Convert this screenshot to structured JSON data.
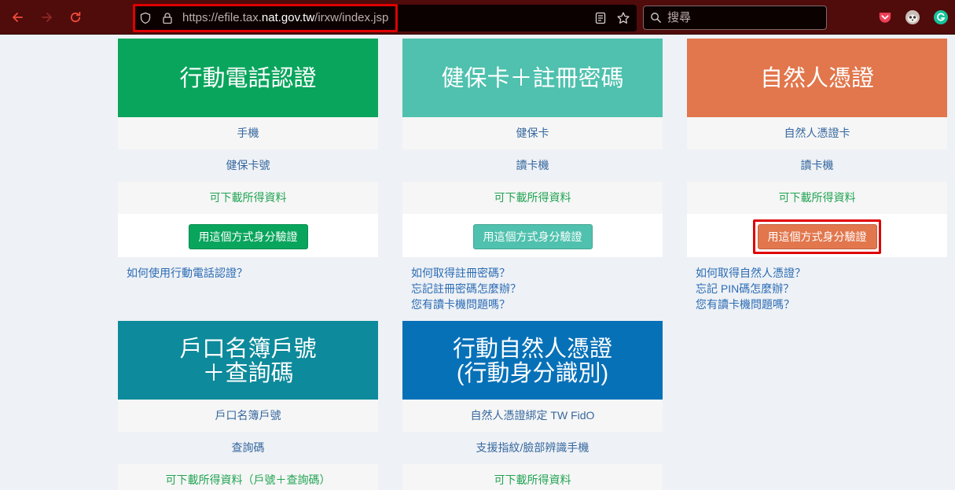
{
  "browser": {
    "toolbar_color": "#500b0b",
    "highlight_color": "#e00000",
    "icons": {
      "back": "arrow-left-icon",
      "forward": "arrow-right-icon",
      "reload": "reload-icon",
      "tracking_protection": "shield-icon",
      "site_security": "lock-icon",
      "reader_view": "reader-view-icon",
      "bookmark": "star-icon",
      "search": "search-icon",
      "pocket": "pocket-icon",
      "profile_extension": "avatar-icon",
      "grammarly": "grammarly-icon"
    },
    "url": {
      "prefix": "https://efile.tax.",
      "domain": "nat.gov.tw",
      "path": "/irxw/index.jsp"
    },
    "search_placeholder": "搜尋"
  },
  "page": {
    "background": "#eef1f5",
    "requirement_text_color": "#36689f",
    "download_text_color": "#22a454",
    "link_color": "#2b6cb5",
    "cards": [
      {
        "title_lines": [
          "行動電話認證"
        ],
        "color": "#09a55c",
        "requirements": [
          "手機",
          "健保卡號"
        ],
        "download_note": "可下載所得資料",
        "button_label": "用這個方式身分驗證",
        "links": [
          "如何使用行動電話認證？"
        ]
      },
      {
        "title_lines": [
          "健保卡＋註冊密碼"
        ],
        "color": "#4fc1ae",
        "requirements": [
          "健保卡",
          "讀卡機"
        ],
        "download_note": "可下載所得資料",
        "button_label": "用這個方式身分驗證",
        "links": [
          "如何取得註冊密碼？",
          "忘記註冊密碼怎麼辦？",
          "您有讀卡機問題嗎？"
        ]
      },
      {
        "title_lines": [
          "自然人憑證"
        ],
        "color": "#e2764c",
        "requirements": [
          "自然人憑證卡",
          "讀卡機"
        ],
        "download_note": "可下載所得資料",
        "button_label": "用這個方式身分驗證",
        "links": [
          "如何取得自然人憑證？",
          "忘記 PIN碼怎麼辦？",
          "您有讀卡機問題嗎？"
        ]
      },
      {
        "title_lines": [
          "戶口名簿戶號",
          "＋查詢碼"
        ],
        "color": "#0d8a9b",
        "requirements": [
          "戶口名簿戶號",
          "查詢碼"
        ],
        "download_note": "可下載所得資料（戶號＋查詢碼）"
      },
      {
        "title_lines": [
          "行動自然人憑證",
          "(行動身分識別)"
        ],
        "color": "#0771b8",
        "requirements": [
          "自然人憑證綁定 TW FidO",
          "支援指紋/臉部辨識手機"
        ],
        "download_note": "可下載所得資料"
      }
    ]
  }
}
